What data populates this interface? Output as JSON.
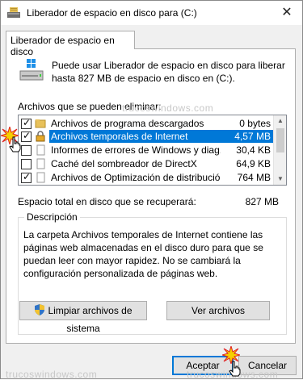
{
  "window": {
    "title": "Liberador de espacio en disco para  (C:)"
  },
  "tab": {
    "label": "Liberador de espacio en disco"
  },
  "intro": {
    "text": "Puede usar Liberador de espacio en disco para liberar hasta 827 MB de espacio en disco en  (C:)."
  },
  "files": {
    "label": "Archivos que se pueden eliminar:",
    "items": [
      {
        "checked": true,
        "name": "Archivos de programa descargados",
        "size": "0 bytes",
        "icon": "folder-icon"
      },
      {
        "checked": true,
        "name": "Archivos temporales de Internet",
        "size": "4,57 MB",
        "icon": "lock-icon",
        "selected": true
      },
      {
        "checked": false,
        "name": "Informes de errores de Windows y diag...",
        "size": "30,4 KB",
        "icon": "blank-file-icon"
      },
      {
        "checked": false,
        "name": "Caché del sombreador de DirectX",
        "size": "64,9 KB",
        "icon": "blank-file-icon"
      },
      {
        "checked": true,
        "name": "Archivos de Optimización de distribución",
        "size": "764 MB",
        "icon": "blank-file-icon"
      }
    ]
  },
  "total": {
    "label": "Espacio total en disco que se recuperará:",
    "value": "827 MB"
  },
  "description": {
    "title": "Descripción",
    "text": "La carpeta Archivos temporales de Internet contiene las páginas web almacenadas en el disco duro para que se puedan leer con mayor rapidez. No se cambiará la configuración personalizada de páginas web."
  },
  "buttons": {
    "cleanup": "Limpiar archivos de sistema",
    "view": "Ver archivos",
    "accept": "Aceptar",
    "cancel": "Cancelar"
  },
  "watermark": "trucoswindows.com",
  "colors": {
    "selection": "#0078d7",
    "accent": "#0078d7"
  }
}
